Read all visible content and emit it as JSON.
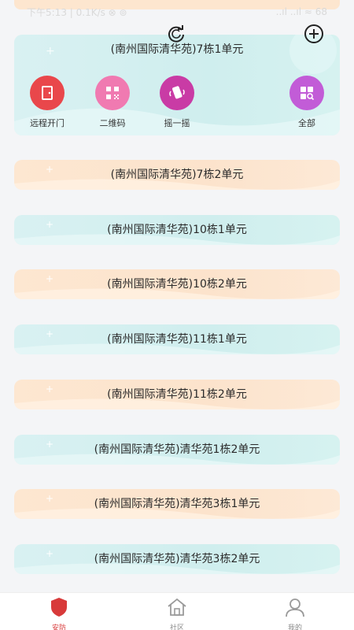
{
  "status_bar": {
    "left_text": "下午5:13 | 0.1K/s ⊗ ⊚",
    "right_text": "..ıl ..ıl ≈ 68"
  },
  "icons": {
    "refresh": "refresh-icon",
    "add": "plus-circle-icon"
  },
  "main_card": {
    "title": "(南州国际清华苑)7栋1单元",
    "actions": [
      {
        "label": "远程开门",
        "icon": "door-icon",
        "color": "#e9474b"
      },
      {
        "label": "二维码",
        "icon": "qrcode-icon",
        "color": "#f07ab1"
      },
      {
        "label": "摇一摇",
        "icon": "shake-icon",
        "color": "#c93ba5"
      },
      {
        "label": "全部",
        "icon": "grid-icon",
        "color": "#c25cd7"
      }
    ]
  },
  "units": [
    "(南州国际清华苑)7栋2单元",
    "(南州国际清华苑)10栋1单元",
    "(南州国际清华苑)10栋2单元",
    "(南州国际清华苑)11栋1单元",
    "(南州国际清华苑)11栋2单元",
    "(南州国际清华苑)清华苑1栋2单元",
    "(南州国际清华苑)清华苑3栋1单元",
    "(南州国际清华苑)清华苑3栋2单元"
  ],
  "tabs": [
    {
      "label": "安防",
      "icon": "shield-icon",
      "active": true
    },
    {
      "label": "社区",
      "icon": "home-icon",
      "active": false
    },
    {
      "label": "我的",
      "icon": "user-icon",
      "active": false
    }
  ],
  "colors": {
    "accent_red": "#d83a3a",
    "teal_card": "#d6f0f1",
    "peach_card": "#fde5cf"
  }
}
